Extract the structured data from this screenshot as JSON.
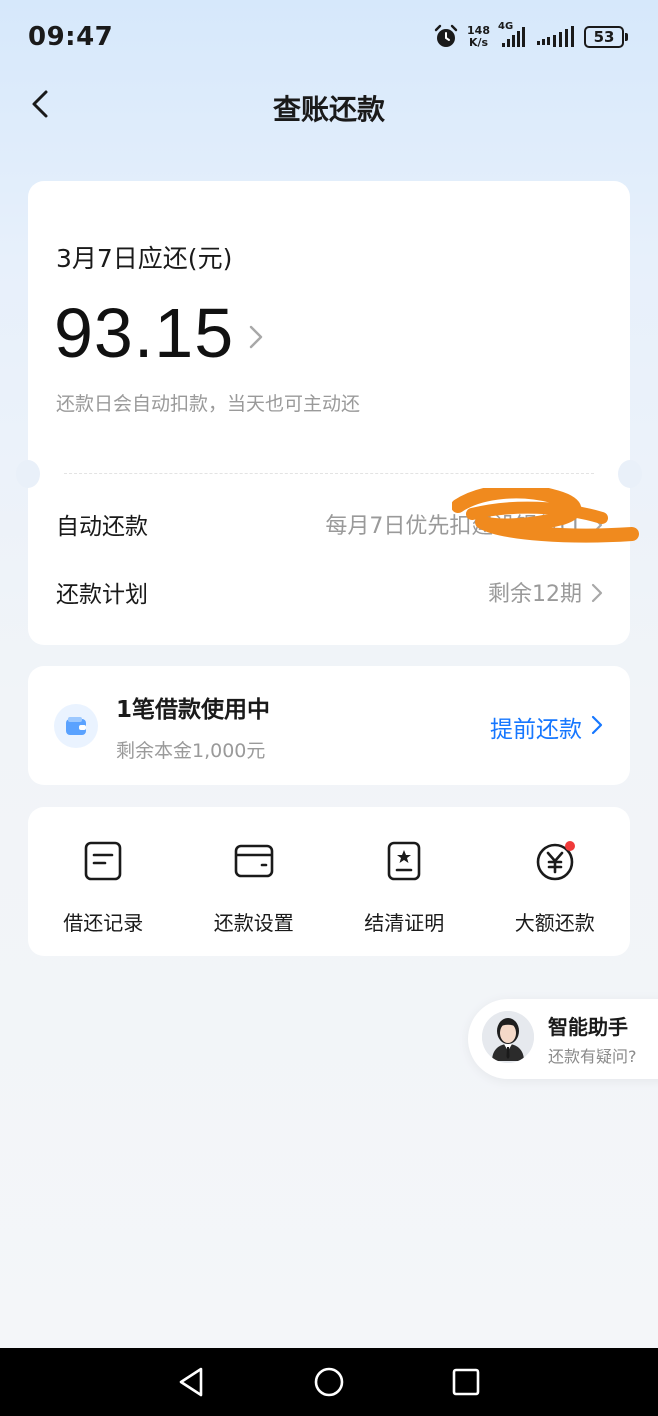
{
  "status_bar": {
    "time": "09:47",
    "speed_value": "148",
    "speed_unit": "K/s",
    "network": "4G",
    "battery": "53"
  },
  "header": {
    "title": "查账还款"
  },
  "due": {
    "label": "3月7日应还(元)",
    "amount": "93.15",
    "note": "还款日会自动扣款，当天也可主动还"
  },
  "rows": {
    "auto_label": "自动还款",
    "auto_value": "每月7日优先扣建设银行(1",
    "plan_label": "还款计划",
    "plan_value": "剩余12期"
  },
  "loan": {
    "title": "1笔借款使用中",
    "sub": "剩余本金1,000元",
    "action": "提前还款"
  },
  "tools": [
    {
      "label": "借还记录",
      "icon": "record-icon"
    },
    {
      "label": "还款设置",
      "icon": "wallet-icon"
    },
    {
      "label": "结清证明",
      "icon": "certificate-icon"
    },
    {
      "label": "大额还款",
      "icon": "yuan-coin-icon"
    }
  ],
  "assistant": {
    "title": "智能助手",
    "sub": "还款有疑问?"
  },
  "colors": {
    "accent": "#1677ff",
    "scribble": "#f08a1e",
    "badge": "#f03a3a"
  }
}
